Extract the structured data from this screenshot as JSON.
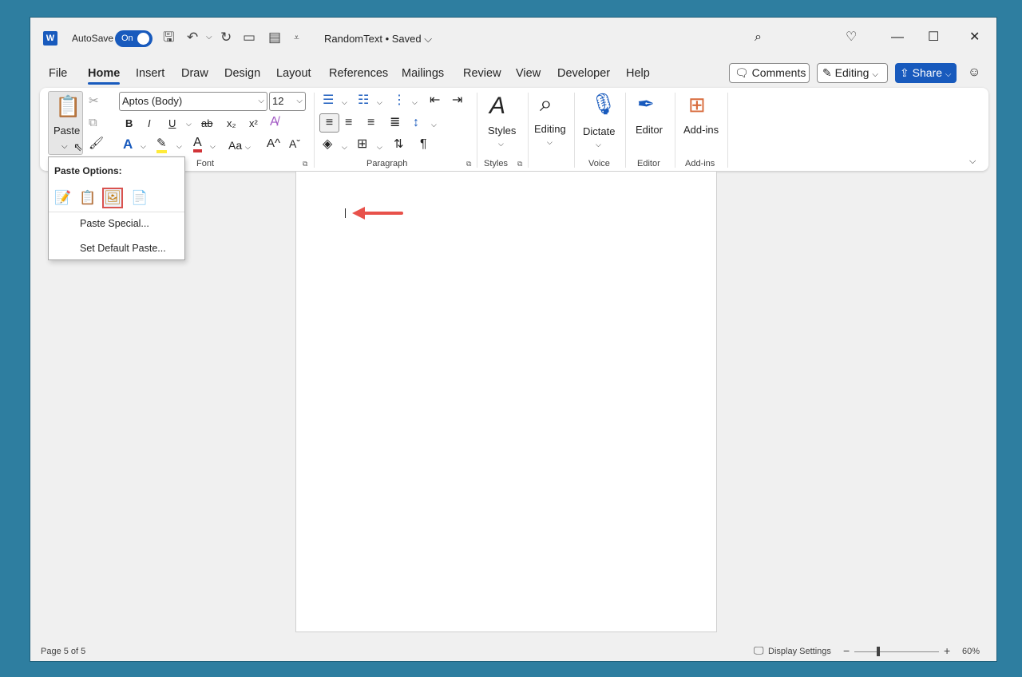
{
  "titlebar": {
    "autosave_label": "AutoSave",
    "autosave_state": "On",
    "doc_title": "RandomText • Saved",
    "doc_title_chevron": "⌵"
  },
  "tabs": [
    {
      "label": "File"
    },
    {
      "label": "Home"
    },
    {
      "label": "Insert"
    },
    {
      "label": "Draw"
    },
    {
      "label": "Design"
    },
    {
      "label": "Layout"
    },
    {
      "label": "References"
    },
    {
      "label": "Mailings"
    },
    {
      "label": "Review"
    },
    {
      "label": "View"
    },
    {
      "label": "Developer"
    },
    {
      "label": "Help"
    }
  ],
  "top_right": {
    "comments_label": "Comments",
    "editing_label": "Editing",
    "share_label": "Share"
  },
  "ribbon": {
    "paste_label": "Paste",
    "font_name": "Aptos (Body)",
    "font_size": "12",
    "bold": "B",
    "italic": "I",
    "underline": "U",
    "strike": "ab",
    "subscript": "x₂",
    "superscript": "x²",
    "case_label": "Aa",
    "grow_font": "A^",
    "shrink_font": "Aˇ",
    "font_group": "Font",
    "paragraph_group": "Paragraph",
    "styles_label": "Styles",
    "styles_group": "Styles",
    "editing_label": "Editing",
    "dictate_label": "Dictate",
    "voice_group": "Voice",
    "editor_label": "Editor",
    "editor_group": "Editor",
    "addins_label": "Add-ins",
    "addins_group": "Add-ins"
  },
  "paste_menu": {
    "title": "Paste Options:",
    "special": "Paste Special...",
    "set_default": "Set Default Paste..."
  },
  "status": {
    "page": "Page 5 of 5",
    "display_settings": "Display Settings",
    "zoom_minus": "−",
    "zoom_plus": "+",
    "zoom": "60%",
    "zoom_fraction": 0.28
  },
  "colors": {
    "accent": "#185abd",
    "highlight_red": "#d9534f",
    "arrow": "#e8514a"
  }
}
